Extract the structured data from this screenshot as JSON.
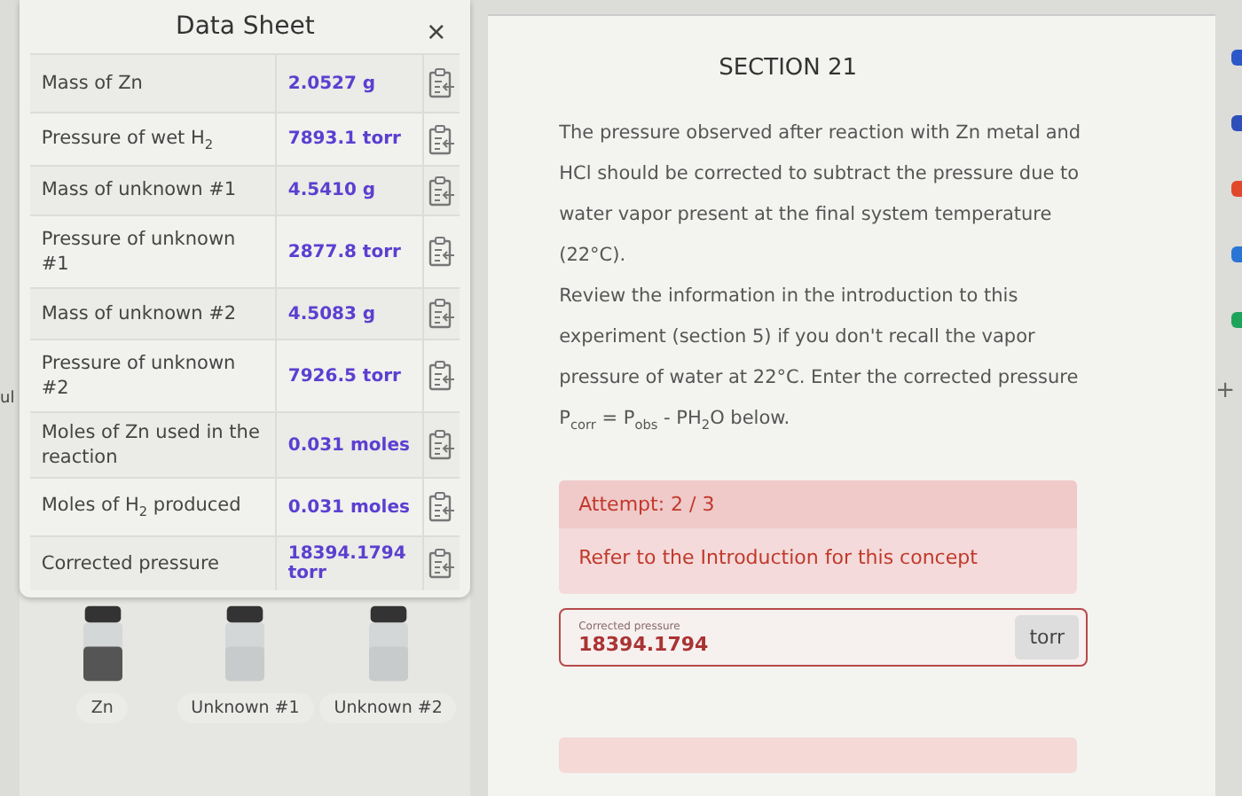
{
  "edge_text": {
    "left": "ul",
    "right": "+"
  },
  "data_sheet": {
    "title": "Data Sheet",
    "close": "×",
    "rows": [
      {
        "label": "Mass of Zn",
        "value": "2.0527 g"
      },
      {
        "label": "Pressure of wet H$_{2}$",
        "value": "7893.1 torr"
      },
      {
        "label": "Mass of unknown #1",
        "value": "4.5410 g"
      },
      {
        "label": "Pressure of unknown #1",
        "value": "2877.8 torr"
      },
      {
        "label": "Mass of unknown #2",
        "value": "4.5083 g"
      },
      {
        "label": "Pressure of unknown #2",
        "value": "7926.5 torr"
      },
      {
        "label": "Moles of Zn used in the reaction",
        "value": "0.031 moles"
      },
      {
        "label": "Moles of H$_{2}$ produced",
        "value": "0.031 moles"
      },
      {
        "label": "Corrected pressure",
        "value": "18394.1794 torr"
      }
    ],
    "samples": [
      {
        "label": "Zn",
        "filled": true
      },
      {
        "label": "Unknown #1",
        "filled": false
      },
      {
        "label": "Unknown #2",
        "filled": false
      }
    ]
  },
  "section": {
    "title": "SECTION 21",
    "paragraphs": [
      "The pressure observed after reaction with Zn metal and HCl should be corrected to subtract the pressure due to water vapor present at the final system temperature (22°C).",
      "Review the information in the introduction to this experiment (section 5) if you don't recall the vapor pressure of water at 22°C. Enter the corrected pressure P$_{corr}$ = P$_{obs}$ - PH$_{2}$O below."
    ],
    "attempt": "Attempt: 2 / 3",
    "hint": "Refer to the Introduction for this concept",
    "answer": {
      "label": "Corrected pressure",
      "value": "18394.1794",
      "unit": "torr"
    }
  },
  "side_icons": [
    {
      "color": "#2b57c9"
    },
    {
      "color": "#2e4fb8"
    },
    {
      "color": "#e0482c"
    },
    {
      "color": "#2a74d6"
    },
    {
      "color": "#1ea45a"
    }
  ]
}
